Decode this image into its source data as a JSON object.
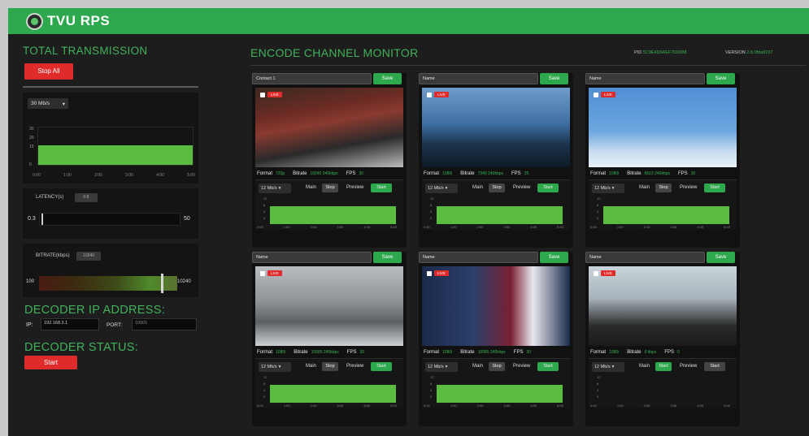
{
  "app": {
    "title": "TVU RPS"
  },
  "left": {
    "total_title": "TOTAL TRANSMISSION",
    "stop_label": "Stop All",
    "rate_select": "30 Mb/s",
    "chart_y": [
      "30",
      "20",
      "10",
      "0"
    ],
    "chart_x": [
      "0:00",
      "1:00",
      "2:00",
      "3:00",
      "4:00",
      "5:00"
    ],
    "latency_label": "LATENCY(s)",
    "latency_chip": "0.8",
    "latency_min": "0.3",
    "latency_max": "50",
    "bitrate_label": "BITRATE(kbps)",
    "bitrate_chip": "10240",
    "bitrate_min": "100",
    "bitrate_max": "10240",
    "decoder_ip_title": "DECODER IP ADDRESS:",
    "ip_label": "IP:",
    "ip_value": "192.168.3.1",
    "port_label": "PORT:",
    "port_value": "10001",
    "decoder_status_title": "DECODER STATUS:",
    "status_label": "Start"
  },
  "monitor": {
    "title": "ENCODE CHANNEL MONITOR",
    "pid_label": "PID",
    "pid_value": "5C9E4D6AEF7D0088",
    "version_label": "VERSION",
    "version_value": "2.8.0fda9197"
  },
  "channels": [
    {
      "name": "Contact 1",
      "save": "Save",
      "live": "LIVE",
      "format_label": "Format",
      "format": "720p",
      "bitrate_label": "Bitrate",
      "bitrate": "10240 240kbps",
      "fps_label": "FPS",
      "fps": "30",
      "rate": "12 Mb/s",
      "main": "Main",
      "stop": "Stop",
      "preview": "Preview",
      "start": "Start"
    },
    {
      "name": "Name",
      "save": "Save",
      "live": "LIVE",
      "format_label": "Format",
      "format": "1080i",
      "bitrate_label": "Bitrate",
      "bitrate": "7340 240kbps",
      "fps_label": "FPS",
      "fps": "25",
      "rate": "12 Mb/s",
      "main": "Main",
      "stop": "Stop",
      "preview": "Preview",
      "start": "Start"
    },
    {
      "name": "Name",
      "save": "Save",
      "live": "LIVE",
      "format_label": "Format",
      "format": "1080i",
      "bitrate_label": "Bitrate",
      "bitrate": "6613 240kbps",
      "fps_label": "FPS",
      "fps": "30",
      "rate": "12 Mb/s",
      "main": "Main",
      "stop": "Stop",
      "preview": "Preview",
      "start": "Start"
    },
    {
      "name": "Name",
      "save": "Save",
      "live": "LIVE",
      "format_label": "Format",
      "format": "1080i",
      "bitrate_label": "Bitrate",
      "bitrate": "10085 240kbps",
      "fps_label": "FPS",
      "fps": "30",
      "rate": "12 Mb/s",
      "main": "Main",
      "stop": "Stop",
      "preview": "Preview",
      "start": "Start"
    },
    {
      "name": "Name",
      "save": "Save",
      "live": "LIVE",
      "format_label": "Format",
      "format": "1080i",
      "bitrate_label": "Bitrate",
      "bitrate": "10085 240kbps",
      "fps_label": "FPS",
      "fps": "30",
      "rate": "12 Mb/s",
      "main": "Main",
      "stop": "Stop",
      "preview": "Preview",
      "start": "Start"
    },
    {
      "name": "Name",
      "save": "Save",
      "live": "LIVE",
      "format_label": "Format",
      "format": "1080i",
      "bitrate_label": "Bitrate",
      "bitrate": "0 kbps",
      "fps_label": "FPS",
      "fps": "0",
      "rate": "12 Mb/s",
      "main": "Main",
      "stop": "Start",
      "preview": "Preview",
      "start": "Start"
    }
  ],
  "mini_chart": {
    "y": [
      "12",
      "8",
      "4",
      "0"
    ],
    "x": [
      "0:00",
      "1:00",
      "2:00",
      "3:00",
      "4:00",
      "5:00"
    ]
  },
  "colors": {
    "brand": "#2ea84c",
    "alert": "#e02b2b",
    "bar": "#5bbd3f"
  }
}
